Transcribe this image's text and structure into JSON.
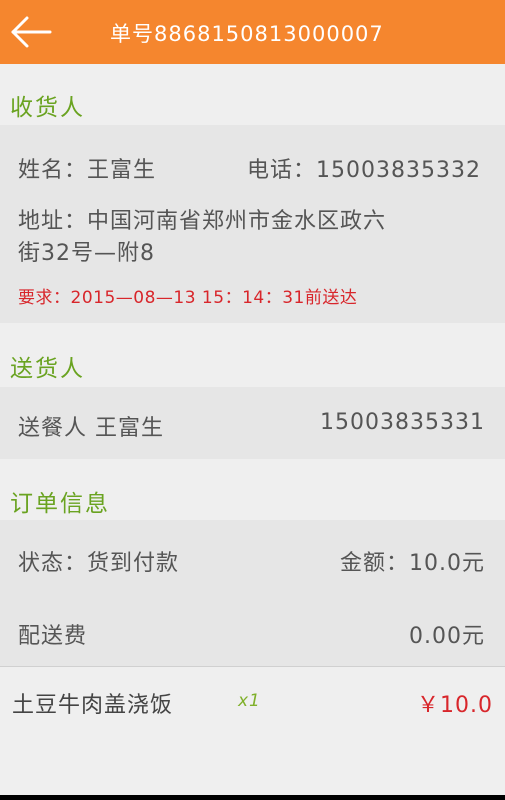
{
  "header": {
    "title": "单号8868150813000007"
  },
  "receiver": {
    "section_title": "收货人",
    "name": "姓名：王富生",
    "phone": "电话：15003835332",
    "address": "地址：中国河南省郑州市金水区政六",
    "address_line2": "街32号—附8",
    "requirement": "要求：2015—08—13  15：14：31前送达"
  },
  "sender": {
    "section_title": "送货人",
    "label": "送餐人  王富生",
    "phone": "15003835331"
  },
  "order": {
    "section_title": "订单信息",
    "status": "状态：货到付款",
    "amount": "金额：10.0元",
    "delivery_fee_label": "配送费",
    "delivery_fee": "0.00元"
  },
  "items": [
    {
      "name": "土豆牛肉盖浇饭",
      "qty": "x1",
      "price": "￥10.0"
    }
  ],
  "colors": {
    "header_bg": "#f5862e",
    "section_title": "#6aa321",
    "highlight_red": "#d8262b",
    "quantity_green": "#7fb02a"
  }
}
